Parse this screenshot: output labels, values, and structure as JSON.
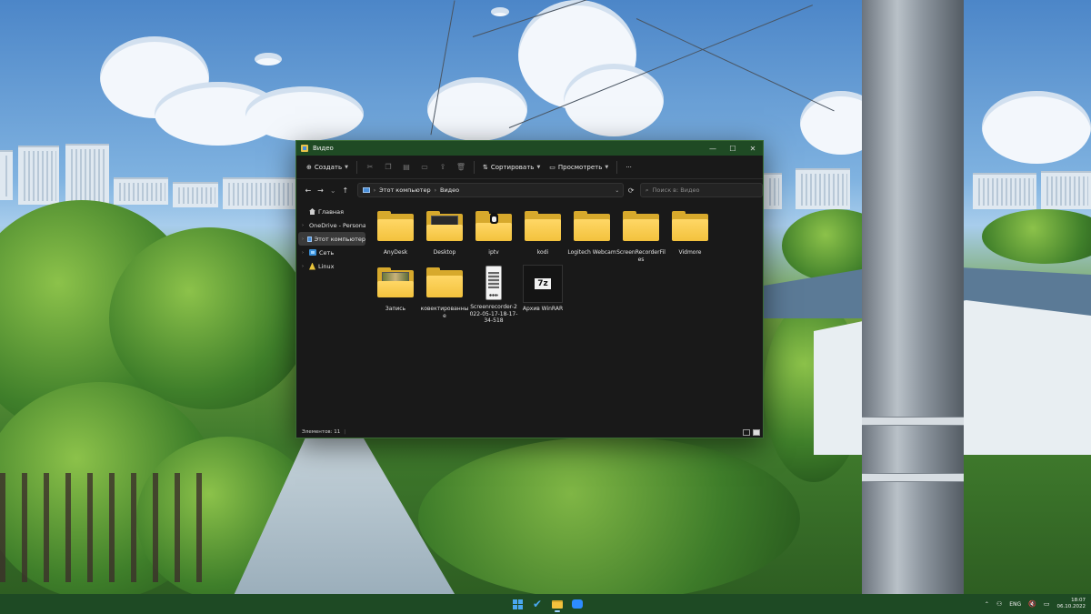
{
  "window": {
    "title": "Видео",
    "controls": {
      "minimize": "—",
      "maximize": "☐",
      "close": "✕"
    }
  },
  "commandbar": {
    "create_label": "Создать",
    "sort_label": "Сортировать",
    "view_label": "Просмотреть",
    "more_label": "···"
  },
  "navigation": {
    "back": "←",
    "forward": "→",
    "recent": "⌄",
    "up": "↑",
    "breadcrumb": [
      "Этот компьютер",
      "Видео"
    ],
    "refresh": "⟳",
    "search_placeholder": "Поиск в: Видео"
  },
  "sidebar": {
    "items": [
      {
        "label": "Главная",
        "icon": "home-icon"
      },
      {
        "label": "OneDrive - Personal",
        "icon": "onedrive-icon"
      },
      {
        "label": "Этот компьютер",
        "icon": "this-pc-icon",
        "active": true
      },
      {
        "label": "Сеть",
        "icon": "network-icon"
      },
      {
        "label": "Linux",
        "icon": "linux-icon"
      }
    ]
  },
  "files": [
    {
      "name": "AnyDesk",
      "type": "folder"
    },
    {
      "name": "Desktop",
      "type": "folder-preview-dark"
    },
    {
      "name": "iptv",
      "type": "folder-penguin"
    },
    {
      "name": "kodi",
      "type": "folder"
    },
    {
      "name": "Logitech Webcam",
      "type": "folder"
    },
    {
      "name": "ScreenRecorderFiles",
      "type": "folder"
    },
    {
      "name": "Vidmore",
      "type": "folder"
    },
    {
      "name": "Запись",
      "type": "folder-preview-scene"
    },
    {
      "name": "ковектированные",
      "type": "folder"
    },
    {
      "name": "Screenrecorder-2022-05-17-18-17-34-518",
      "type": "video-phone"
    },
    {
      "name": "Архив WinRAR",
      "type": "archive-7z"
    }
  ],
  "archive_icon_text": "7z",
  "status": {
    "items_count": "Элементов: 11"
  },
  "tray": {
    "language": "ENG",
    "time": "18:07",
    "date": "06.10.2022"
  }
}
